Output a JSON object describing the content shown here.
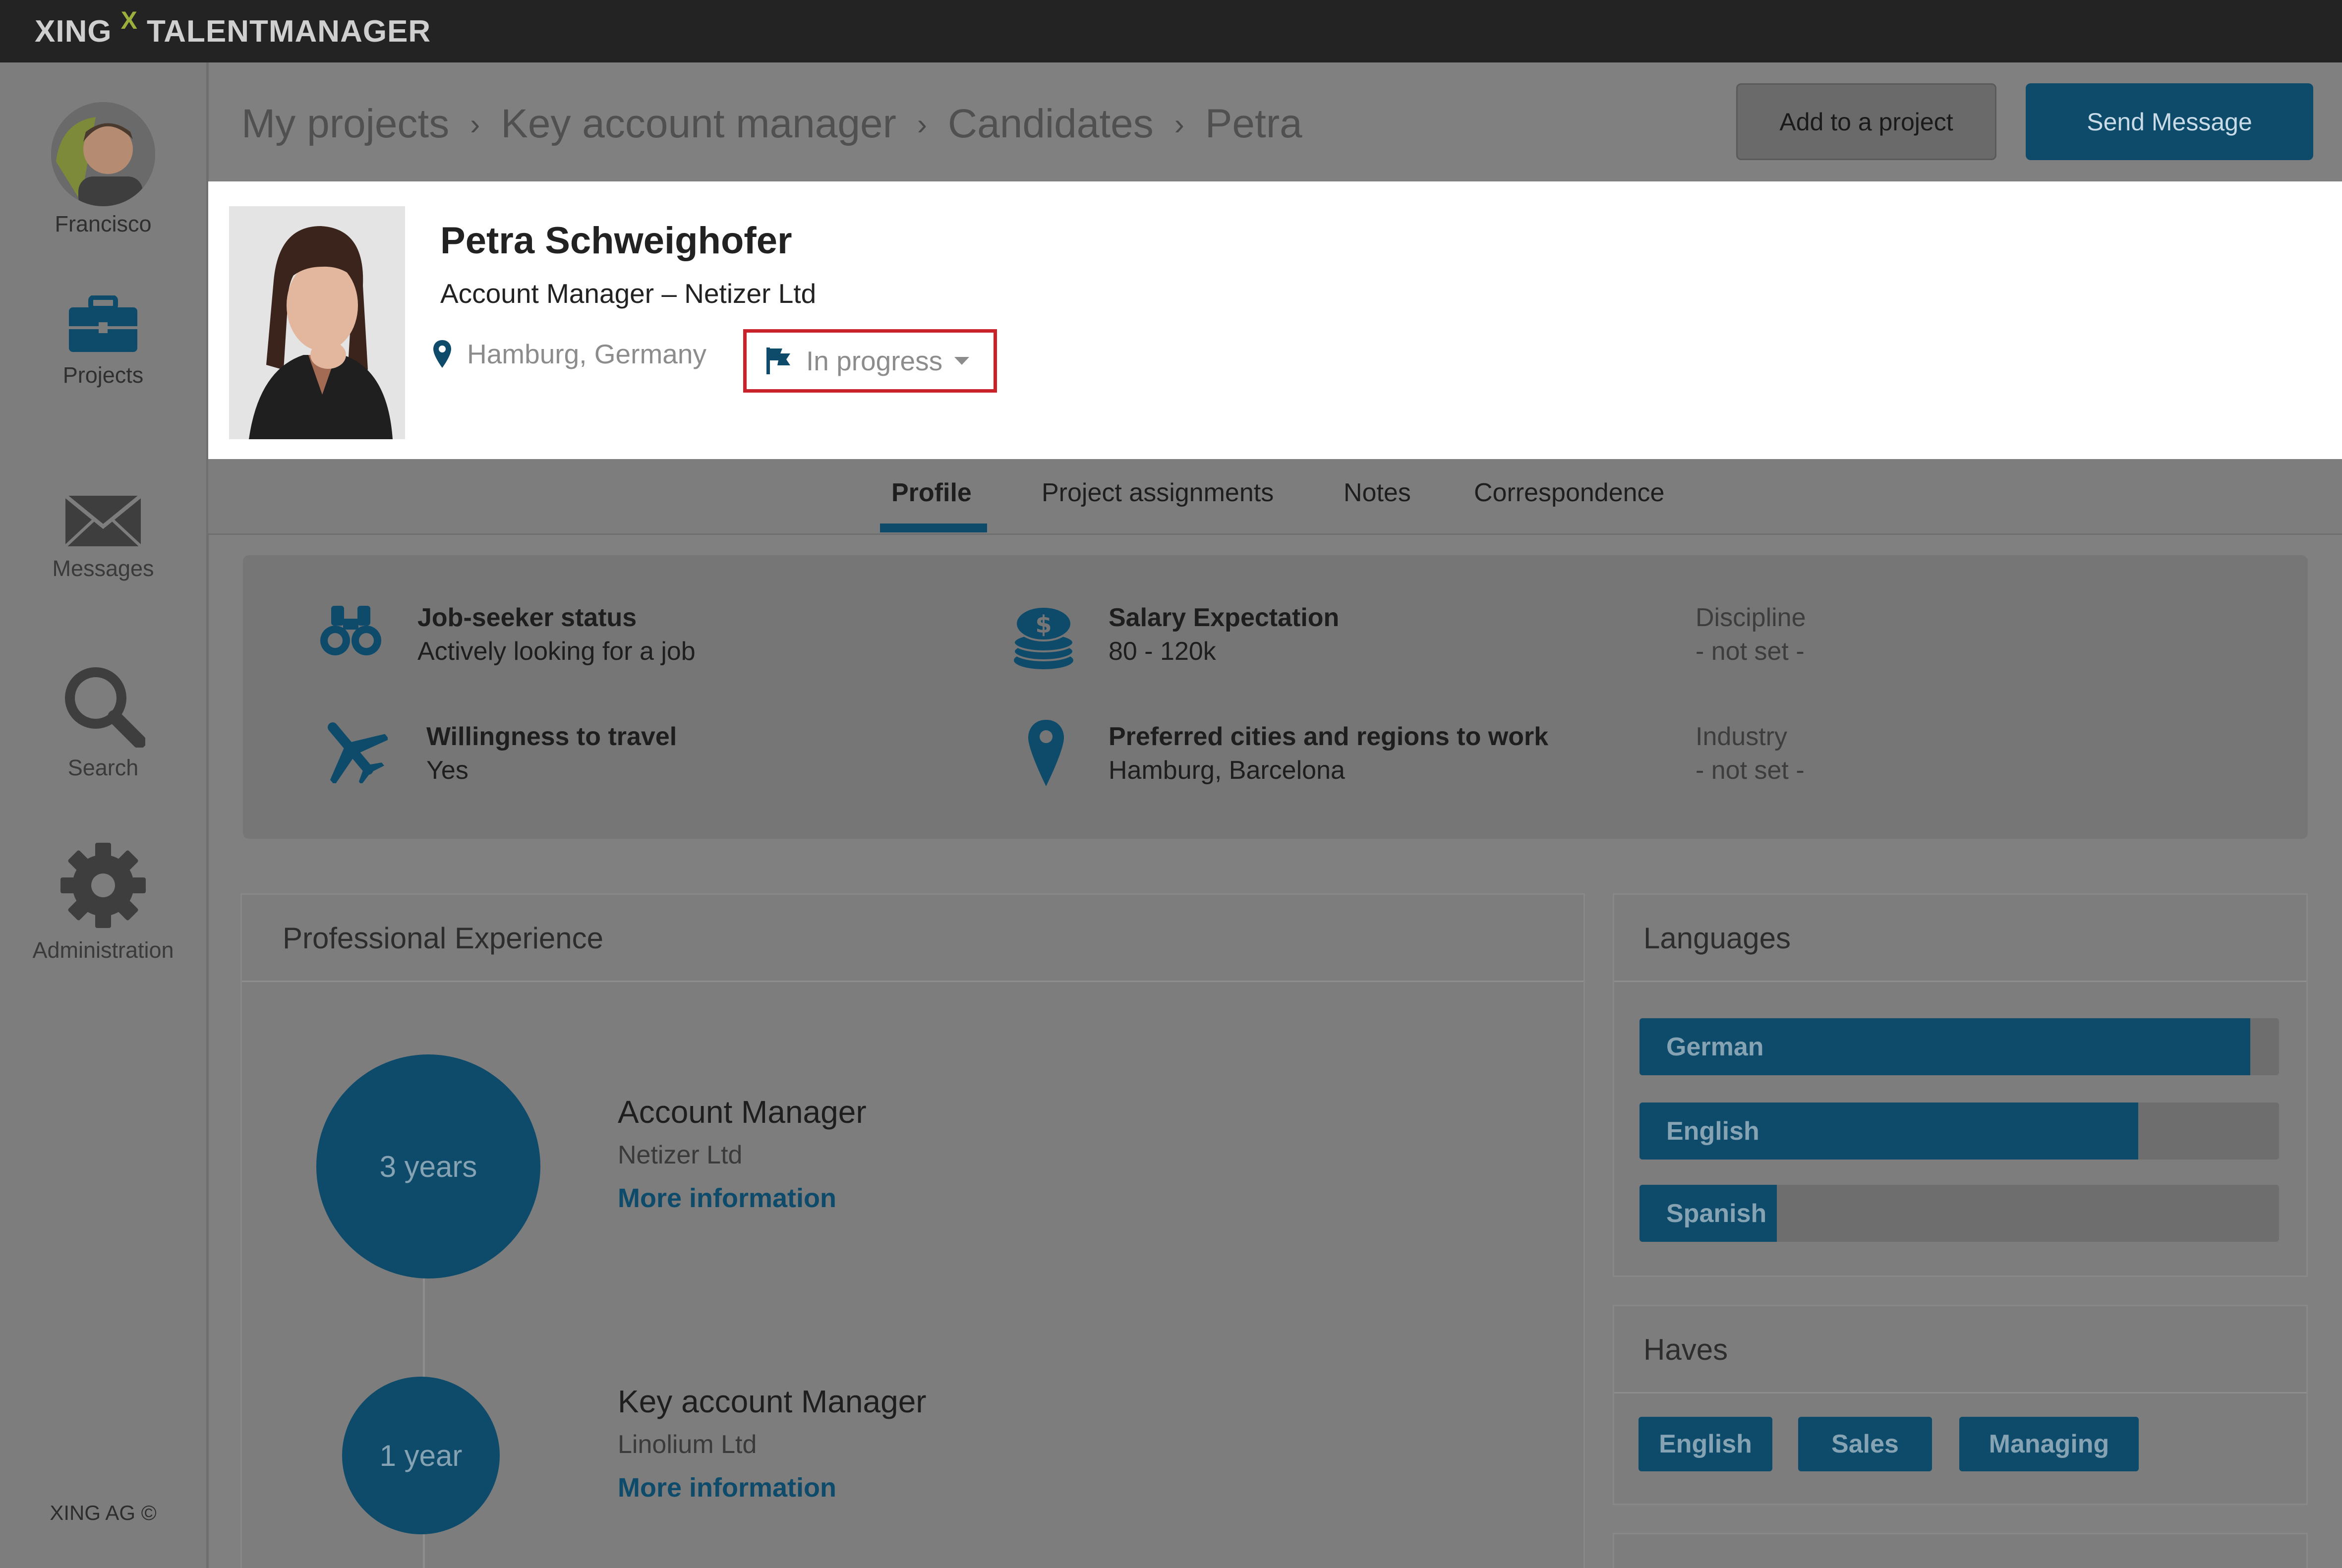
{
  "app": {
    "brand_left": "XING",
    "brand_mark": "X",
    "brand_right": "TALENTMANAGER"
  },
  "sidebar": {
    "user_name": "Francisco",
    "items": [
      {
        "label": "Projects",
        "icon": "briefcase-icon"
      },
      {
        "label": "Messages",
        "icon": "envelope-icon"
      },
      {
        "label": "Search",
        "icon": "search-icon"
      },
      {
        "label": "Administration",
        "icon": "gear-icon"
      }
    ],
    "footer": "XING AG ©"
  },
  "breadcrumb": [
    "My projects",
    "Key account manager",
    "Candidates",
    "Petra"
  ],
  "actions": {
    "add_to_project": "Add to a project",
    "send_message": "Send Message"
  },
  "candidate": {
    "name": "Petra Schweighofer",
    "role": "Account Manager – Netizer Ltd",
    "location": "Hamburg, Germany",
    "status": "In progress"
  },
  "tabs": [
    "Profile",
    "Project assignments",
    "Notes",
    "Correspondence"
  ],
  "info": {
    "job_seeker": {
      "title": "Job-seeker status",
      "value": "Actively looking for a job"
    },
    "salary": {
      "title": "Salary Expectation",
      "value": "80 - 120k"
    },
    "discipline": {
      "title": "Discipline",
      "value": "- not set -"
    },
    "travel": {
      "title": "Willingness to travel",
      "value": "Yes"
    },
    "cities": {
      "title": "Preferred cities and regions to work",
      "value": "Hamburg, Barcelona"
    },
    "industry": {
      "title": "Industry",
      "value": "- not set -"
    }
  },
  "experience": {
    "title": "Professional Experience",
    "items": [
      {
        "duration": "3 years",
        "title": "Account Manager",
        "company": "Netizer Ltd",
        "link": "More information"
      },
      {
        "duration": "1 year",
        "title": "Key account Manager",
        "company": "Linolium Ltd",
        "link": "More information"
      }
    ]
  },
  "languages": {
    "title": "Languages",
    "items": [
      {
        "name": "German",
        "level": 0.955
      },
      {
        "name": "English",
        "level": 0.78
      },
      {
        "name": "Spanish",
        "level": 0.215
      }
    ]
  },
  "haves": {
    "title": "Haves",
    "tags": [
      "English",
      "Sales",
      "Managing"
    ]
  },
  "colors": {
    "accent": "#0e4b6b",
    "highlight_border": "#c8232a",
    "overlay_gray": "#808080"
  }
}
